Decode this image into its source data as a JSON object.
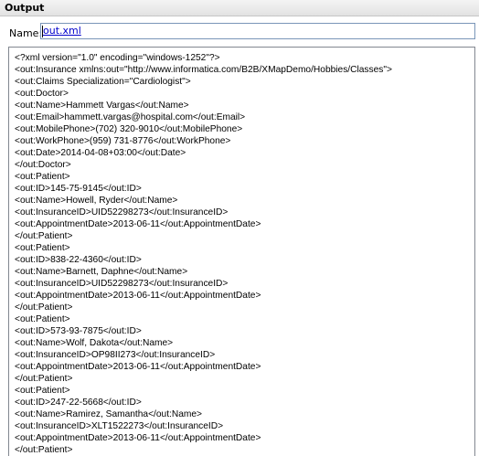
{
  "header": {
    "title": "Output"
  },
  "name_field": {
    "label": "Name:",
    "value": "out.xml"
  },
  "xml_output": {
    "lines": [
      "<?xml version=\"1.0\" encoding=\"windows-1252\"?>",
      "<out:Insurance xmlns:out=\"http://www.informatica.com/B2B/XMapDemo/Hobbies/Classes\">",
      "<out:Claims Specialization=\"Cardiologist\">",
      "<out:Doctor>",
      "<out:Name>Hammett Vargas</out:Name>",
      "<out:Email>hammett.vargas@hospital.com</out:Email>",
      "<out:MobilePhone>(702) 320-9010</out:MobilePhone>",
      "<out:WorkPhone>(959) 731-8776</out:WorkPhone>",
      "<out:Date>2014-04-08+03:00</out:Date>",
      "</out:Doctor>",
      "<out:Patient>",
      "<out:ID>145-75-9145</out:ID>",
      "<out:Name>Howell, Ryder</out:Name>",
      "<out:InsuranceID>UID52298273</out:InsuranceID>",
      "<out:AppointmentDate>2013-06-11</out:AppointmentDate>",
      "</out:Patient>",
      "<out:Patient>",
      "<out:ID>838-22-4360</out:ID>",
      "<out:Name>Barnett, Daphne</out:Name>",
      "<out:InsuranceID>UID52298273</out:InsuranceID>",
      "<out:AppointmentDate>2013-06-11</out:AppointmentDate>",
      "</out:Patient>",
      "<out:Patient>",
      "<out:ID>573-93-7875</out:ID>",
      "<out:Name>Wolf, Dakota</out:Name>",
      "<out:InsuranceID>OP98II273</out:InsuranceID>",
      "<out:AppointmentDate>2013-06-11</out:AppointmentDate>",
      "</out:Patient>",
      "<out:Patient>",
      "<out:ID>247-22-5668</out:ID>",
      "<out:Name>Ramirez, Samantha</out:Name>",
      "<out:InsuranceID>XLT1522273</out:InsuranceID>",
      "<out:AppointmentDate>2013-06-11</out:AppointmentDate>",
      "</out:Patient>"
    ]
  }
}
